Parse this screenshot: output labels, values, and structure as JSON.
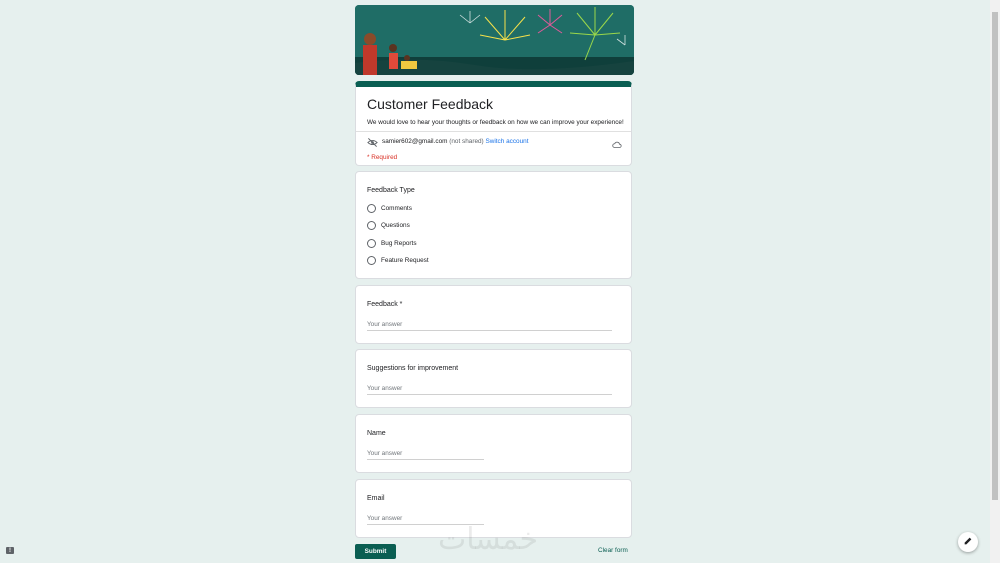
{
  "form": {
    "title": "Customer Feedback",
    "description": "We would love to hear your thoughts or feedback on how we can improve your experience!",
    "account_email": "samier602@gmail.com",
    "not_shared": "(not shared)",
    "switch_account": "Switch account",
    "required_note": "* Required"
  },
  "questions": {
    "feedback_type": {
      "label": "Feedback Type",
      "options": [
        "Comments",
        "Questions",
        "Bug Reports",
        "Feature Request"
      ]
    },
    "feedback": {
      "label": "Feedback *",
      "placeholder": "Your answer"
    },
    "suggestions": {
      "label": "Suggestions for improvement",
      "placeholder": "Your answer"
    },
    "name": {
      "label": "Name",
      "placeholder": "Your answer"
    },
    "email": {
      "label": "Email",
      "placeholder": "Your answer"
    }
  },
  "actions": {
    "submit": "Submit",
    "clear": "Clear form"
  },
  "watermark": "خمسات",
  "colors": {
    "accent": "#0a5e52",
    "background": "#e6f0ee",
    "link": "#1a73e8",
    "required": "#d93025"
  }
}
